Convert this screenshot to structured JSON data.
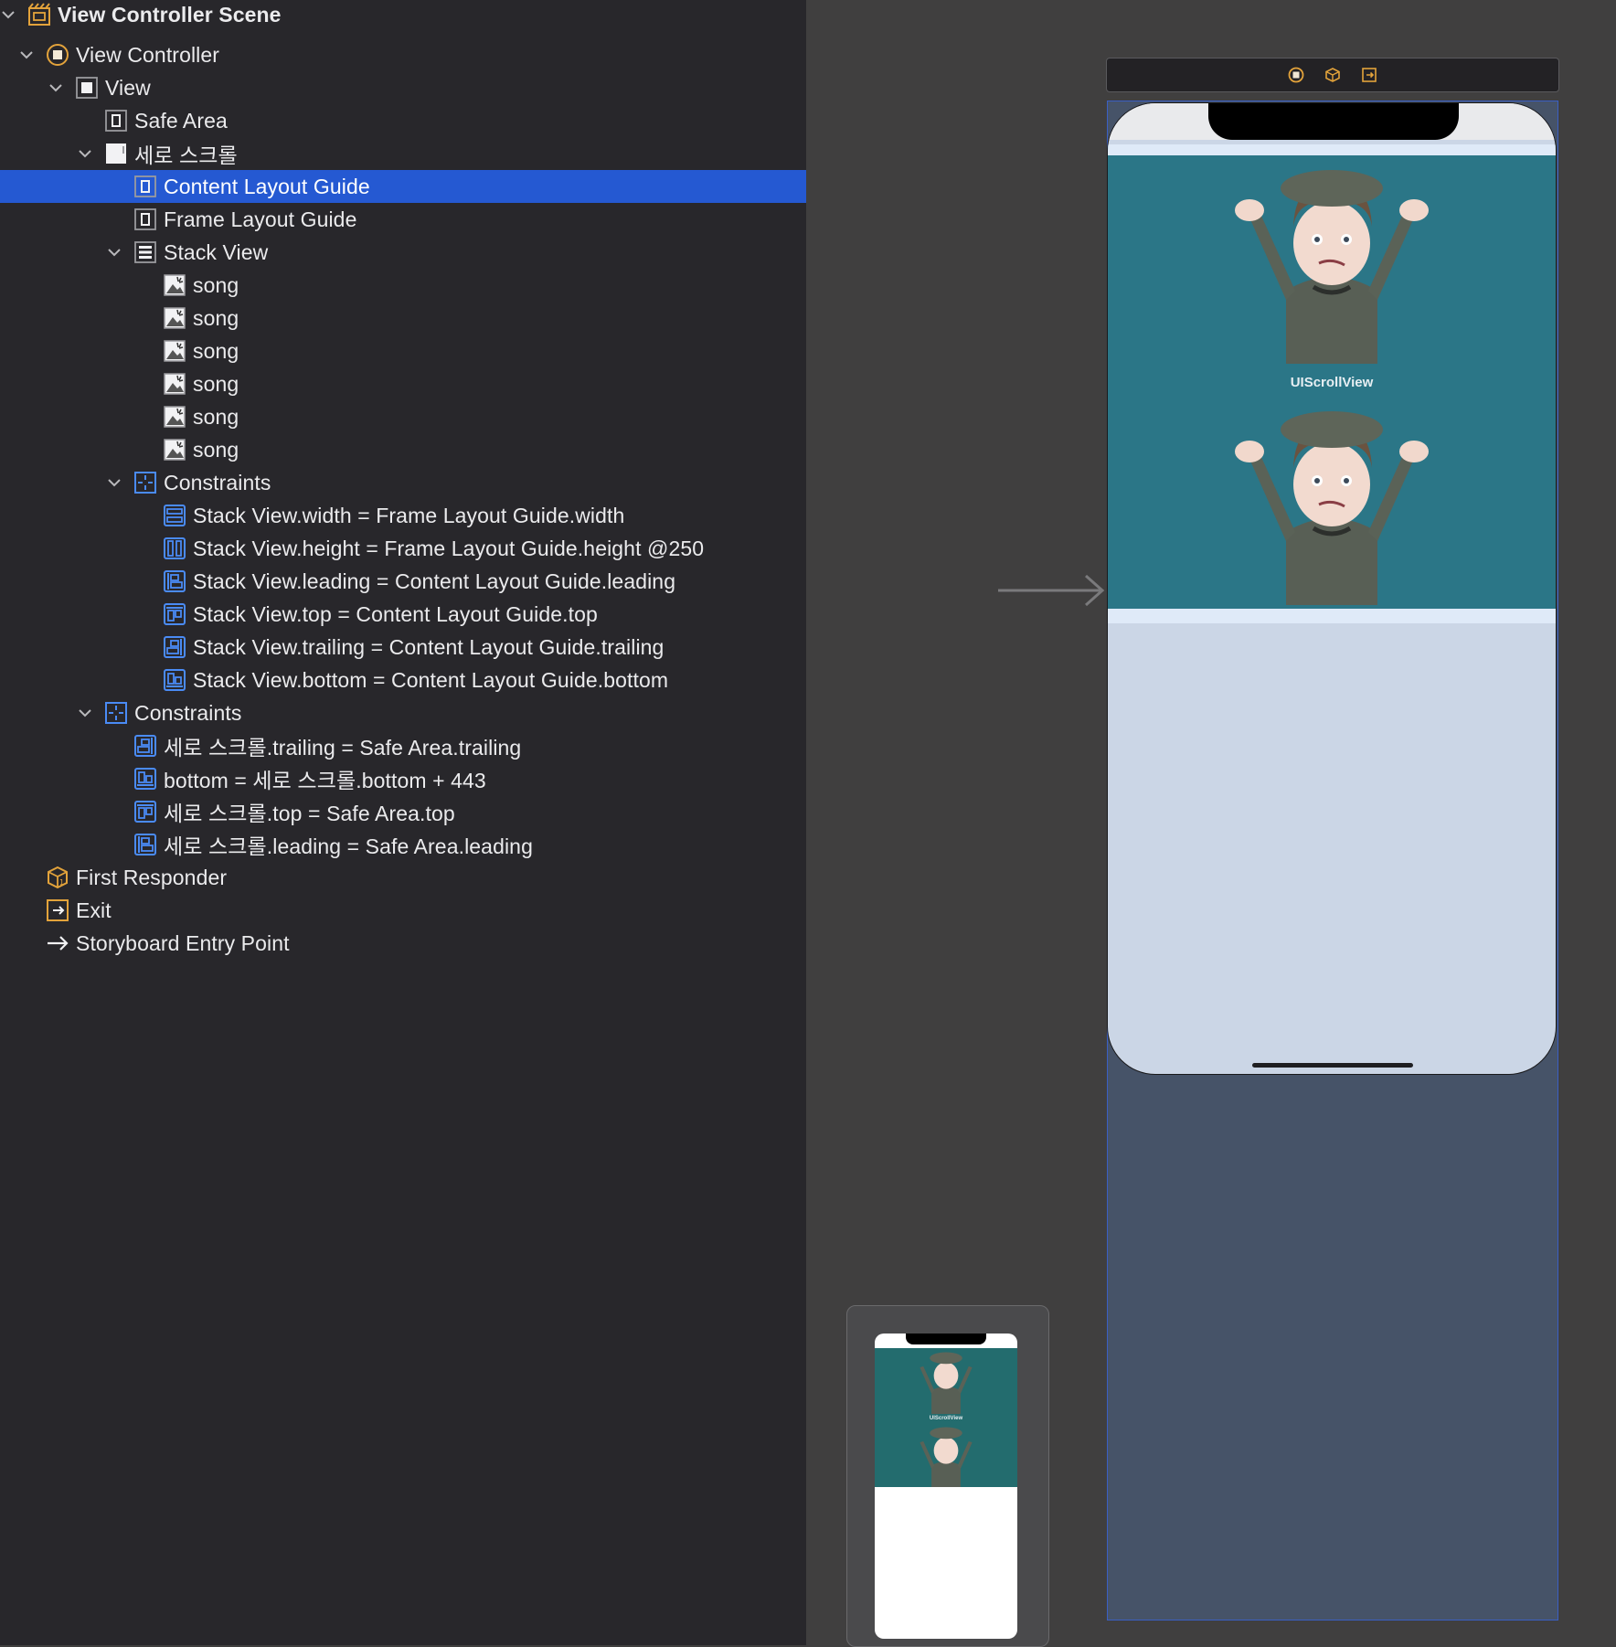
{
  "outline": {
    "items": [
      {
        "label": "View Controller Scene",
        "icon": "scene-icon"
      },
      {
        "label": "View Controller",
        "icon": "view-controller-icon"
      },
      {
        "label": "View",
        "icon": "view-icon"
      },
      {
        "label": "Safe Area",
        "icon": "layout-guide-icon"
      },
      {
        "label": "세로 스크롤",
        "icon": "scroll-view-icon"
      },
      {
        "label": "Content Layout Guide",
        "icon": "layout-guide-icon",
        "selected": true
      },
      {
        "label": "Frame Layout Guide",
        "icon": "layout-guide-icon"
      },
      {
        "label": "Stack View",
        "icon": "stack-view-icon"
      },
      {
        "label": "song",
        "icon": "image-view-icon"
      },
      {
        "label": "song",
        "icon": "image-view-icon"
      },
      {
        "label": "song",
        "icon": "image-view-icon"
      },
      {
        "label": "song",
        "icon": "image-view-icon"
      },
      {
        "label": "song",
        "icon": "image-view-icon"
      },
      {
        "label": "song",
        "icon": "image-view-icon"
      },
      {
        "label": "Constraints",
        "icon": "constraints-icon"
      },
      {
        "label": "Stack View.width = Frame Layout Guide.width",
        "icon": "width-constraint-icon"
      },
      {
        "label": "Stack View.height = Frame Layout Guide.height @250",
        "icon": "height-constraint-icon"
      },
      {
        "label": "Stack View.leading = Content Layout Guide.leading",
        "icon": "leading-constraint-icon"
      },
      {
        "label": "Stack View.top = Content Layout Guide.top",
        "icon": "top-constraint-icon"
      },
      {
        "label": "Stack View.trailing = Content Layout Guide.trailing",
        "icon": "trailing-constraint-icon"
      },
      {
        "label": "Stack View.bottom = Content Layout Guide.bottom",
        "icon": "bottom-constraint-icon"
      },
      {
        "label": "Constraints",
        "icon": "constraints-icon"
      },
      {
        "label": "세로 스크롤.trailing = Safe Area.trailing",
        "icon": "trailing-constraint-icon"
      },
      {
        "label": "bottom = 세로 스크롤.bottom + 443",
        "icon": "bottom-constraint-icon"
      },
      {
        "label": "세로 스크롤.top = Safe Area.top",
        "icon": "top-constraint-icon"
      },
      {
        "label": "세로 스크롤.leading = Safe Area.leading",
        "icon": "leading-constraint-icon"
      },
      {
        "label": "First Responder",
        "icon": "first-responder-icon"
      },
      {
        "label": "Exit",
        "icon": "exit-icon"
      },
      {
        "label": "Storyboard Entry Point",
        "icon": "entry-point-arrow-icon"
      }
    ]
  },
  "canvas": {
    "scene_bar_icons": [
      "view-controller-icon",
      "first-responder-icon",
      "exit-icon"
    ],
    "scroll_caption": "UIScrollView",
    "preview_caption": "UIScrollView"
  },
  "colors": {
    "selection": "#2559d2",
    "outline_bg": "#28272b",
    "canvas_bg": "#403f3f",
    "scroll_bg": "#2b7687",
    "device_bg": "#cbd6e6",
    "accent_orange": "#e3a33b",
    "constraint_blue": "#4a8bf5"
  }
}
